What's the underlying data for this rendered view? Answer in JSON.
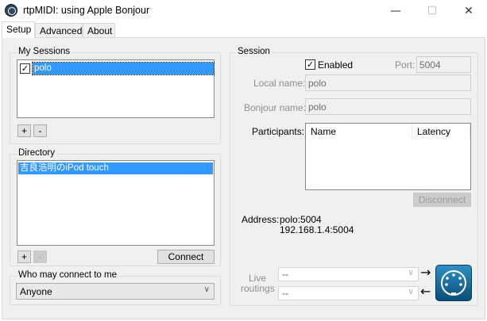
{
  "window": {
    "title": "rtpMIDI: using Apple Bonjour",
    "minimize": "—",
    "maximize": "☐",
    "close": "✕"
  },
  "tabs": [
    {
      "label": "Setup",
      "active": true
    },
    {
      "label": "Advanced",
      "active": false
    },
    {
      "label": "About",
      "active": false
    }
  ],
  "my_sessions": {
    "label": "My Sessions",
    "items": [
      {
        "name": "polo",
        "checked": true,
        "selected": true
      }
    ],
    "add_label": "+",
    "remove_label": "-"
  },
  "directory": {
    "label": "Directory",
    "items": [
      {
        "name": "吉良浩明のiPod touch",
        "selected": true
      }
    ],
    "add_label": "+",
    "remove_label": "-",
    "connect_label": "Connect"
  },
  "who_may_connect": {
    "label": "Who may connect to me",
    "value": "Anyone"
  },
  "session": {
    "label": "Session",
    "enabled_label": "Enabled",
    "enabled_checked": true,
    "port_label": "Port:",
    "port_value": "5004",
    "local_name_label": "Local name:",
    "local_name_value": "polo",
    "bonjour_name_label": "Bonjour name:",
    "bonjour_name_value": "polo",
    "participants_label": "Participants:",
    "columns": [
      "Name",
      "Latency"
    ],
    "disconnect_label": "Disconnect",
    "address_label": "Address:",
    "address_line1": "polo:5004",
    "address_line2": "192.168.1.4:5004",
    "live_routings_label_1": "Live",
    "live_routings_label_2": "routings",
    "routing_in_value": "--",
    "routing_out_value": "--",
    "arrow_right": "→",
    "arrow_left": "←"
  },
  "colors": {
    "selection": "#3399ff",
    "panel_bg": "#f0f0f0",
    "midi_icon_bg": "#0d5f8a"
  }
}
